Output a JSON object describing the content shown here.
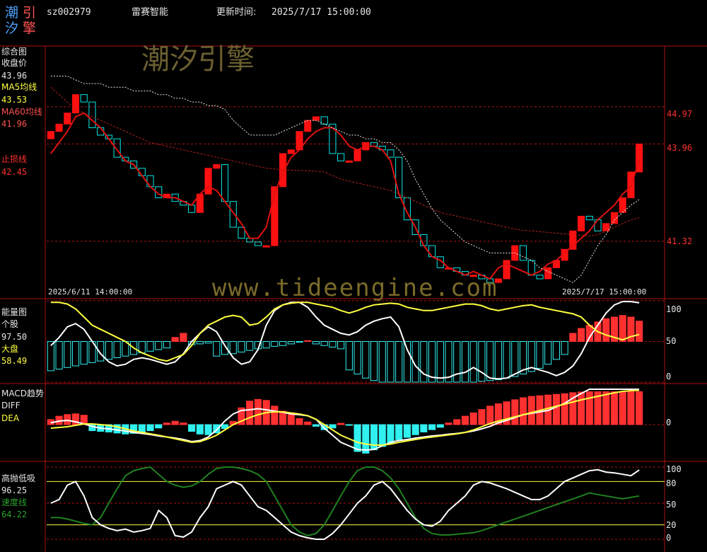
{
  "header": {
    "logo_chars": [
      "潮",
      "引",
      "汐",
      "擎"
    ],
    "code": "sz002979",
    "name": "雷赛智能",
    "update_label": "更新时间:",
    "update_time": "2025/7/17 15:00:00"
  },
  "watermarks": {
    "brand": "潮汐引擎",
    "url": "www.tideengine.com"
  },
  "main_panel": {
    "title": "综合图",
    "close_label": "收盘价",
    "close_value": "43.96",
    "ma5_label": "MA5均线",
    "ma5_value": "43.53",
    "ma60_label": "MA60均线",
    "ma60_value": "41.96",
    "stop_label": "止损线",
    "stop_value": "42.45",
    "price_ticks": [
      "44.97",
      "43.96",
      "41.32"
    ],
    "start_date": "2025/6/11 14:00:00",
    "end_date": "2025/7/17 15:00:00"
  },
  "energy_panel": {
    "title": "能量图",
    "stock_label": "个股",
    "stock_value": "97.50",
    "market_label": "大盘",
    "market_value": "58.49",
    "ticks": [
      "100",
      "50",
      "0"
    ]
  },
  "macd_panel": {
    "title": "MACD趋势",
    "diff_label": "DIFF",
    "dea_label": "DEA",
    "ticks": [
      "0"
    ]
  },
  "hilo_panel": {
    "title": "高抛低吸",
    "value": "96.25",
    "speed_label": "速度线",
    "speed_value": "64.22",
    "ticks": [
      "100",
      "80",
      "50",
      "20",
      "0"
    ]
  },
  "colors": {
    "up": "#ff1010",
    "down": "#00e8e8",
    "ma": "#e01010",
    "ma60": "#b02020",
    "yellow": "#ffff40",
    "white": "#ffffff",
    "green": "#208020",
    "frame": "#b01010",
    "bull": "#ff3030",
    "bear": "#30f0f0"
  },
  "chart_data": [
    {
      "type": "candlestick",
      "title": "综合图",
      "ylim": [
        39.8,
        46.6
      ],
      "x_range": [
        "2025/6/11 14:00:00",
        "2025/7/17 15:00:00"
      ],
      "ticks": [
        44.97,
        43.96,
        41.32
      ],
      "series": [
        {
          "name": "收盘价",
          "values": [
            44.3,
            44.5,
            44.8,
            45.3,
            45.1,
            44.4,
            44.2,
            44.1,
            43.6,
            43.5,
            43.3,
            43.1,
            42.8,
            42.5,
            42.6,
            42.4,
            42.3,
            42.1,
            42.6,
            43.3,
            43.4,
            42.4,
            41.7,
            41.4,
            41.3,
            41.2,
            41.2,
            42.8,
            43.7,
            43.8,
            44.3,
            44.6,
            44.7,
            44.5,
            43.7,
            43.5,
            43.5,
            43.8,
            44.0,
            43.9,
            43.8,
            43.6,
            42.5,
            41.9,
            41.5,
            41.2,
            40.9,
            40.6,
            40.6,
            40.5,
            40.4,
            40.4,
            40.3,
            40.2,
            40.3,
            40.8,
            41.2,
            40.8,
            40.4,
            40.3,
            40.6,
            40.8,
            41.1,
            41.6,
            42.0,
            41.9,
            41.6,
            41.8,
            42.1,
            42.5,
            43.2,
            43.96
          ]
        },
        {
          "name": "MA5均线",
          "values": [
            43.7,
            44.0,
            44.3,
            44.7,
            44.8,
            44.6,
            44.4,
            44.1,
            43.8,
            43.5,
            43.4,
            43.1,
            42.8,
            42.6,
            42.5,
            42.5,
            42.4,
            42.3,
            42.6,
            42.8,
            42.7,
            42.4,
            42.1,
            41.8,
            41.4,
            41.4,
            41.7,
            42.6,
            43.2,
            43.6,
            43.8,
            44.1,
            44.3,
            44.4,
            44.4,
            44.2,
            43.9,
            43.8,
            43.9,
            43.9,
            43.8,
            43.5,
            42.6,
            42.1,
            41.7,
            41.2,
            40.9,
            40.8,
            40.6,
            40.5,
            40.4,
            40.5,
            40.4,
            40.3,
            40.6,
            40.7,
            40.6,
            40.5,
            40.4,
            40.5,
            40.7,
            40.8,
            41.0,
            41.2,
            41.4,
            41.6,
            41.9,
            42.1,
            42.3,
            42.6,
            42.8,
            43.53
          ]
        },
        {
          "name": "MA60均线",
          "values": [
            45.5,
            45.3,
            45.1,
            44.9,
            44.8,
            44.7,
            44.6,
            44.5,
            44.4,
            44.3,
            44.2,
            44.1,
            44.0,
            43.95,
            43.9,
            43.85,
            43.8,
            43.75,
            43.7,
            43.65,
            43.6,
            43.55,
            43.5,
            43.45,
            43.4,
            43.35,
            43.3,
            43.28,
            43.26,
            43.25,
            43.24,
            43.23,
            43.22,
            43.2,
            43.1,
            43.0,
            42.95,
            42.9,
            42.85,
            42.8,
            42.75,
            42.7,
            42.6,
            42.5,
            42.4,
            42.3,
            42.2,
            42.1,
            42.05,
            42.0,
            41.95,
            41.9,
            41.85,
            41.8,
            41.75,
            41.7,
            41.65,
            41.62,
            41.6,
            41.58,
            41.56,
            41.54,
            41.52,
            41.5,
            41.48,
            41.46,
            41.5,
            41.6,
            41.7,
            41.8,
            41.9,
            41.96
          ]
        },
        {
          "name": "止损线",
          "values": [
            45.8,
            45.8,
            45.8,
            45.7,
            45.6,
            45.6,
            45.6,
            45.5,
            45.5,
            45.5,
            45.4,
            45.4,
            45.4,
            45.3,
            45.3,
            45.2,
            45.2,
            45.1,
            45.1,
            45.0,
            45.0,
            44.9,
            44.6,
            44.4,
            44.2,
            44.2,
            44.2,
            44.2,
            44.3,
            44.4,
            44.5,
            44.6,
            44.6,
            44.5,
            44.4,
            44.3,
            44.2,
            44.2,
            44.1,
            44.1,
            44.0,
            44.0,
            43.8,
            43.5,
            43.0,
            42.6,
            42.2,
            41.9,
            41.7,
            41.5,
            41.3,
            41.2,
            41.1,
            41.0,
            41.0,
            41.0,
            41.0,
            40.9,
            40.8,
            40.6,
            40.5,
            40.4,
            40.3,
            40.2,
            40.4,
            40.8,
            41.2,
            41.5,
            41.9,
            42.1,
            42.3,
            42.45
          ]
        }
      ]
    },
    {
      "type": "bar+line",
      "title": "能量图",
      "ylim": [
        0,
        100
      ],
      "ticks": [
        100,
        50,
        0
      ],
      "series": [
        {
          "name": "个股",
          "values": [
            45,
            55,
            68,
            72,
            65,
            50,
            35,
            25,
            20,
            22,
            28,
            30,
            28,
            25,
            22,
            25,
            35,
            50,
            60,
            68,
            62,
            45,
            30,
            22,
            25,
            40,
            70,
            88,
            95,
            98,
            98,
            92,
            80,
            70,
            65,
            60,
            58,
            62,
            70,
            75,
            78,
            80,
            68,
            40,
            20,
            10,
            6,
            5,
            6,
            10,
            12,
            18,
            12,
            5,
            4,
            5,
            10,
            15,
            18,
            15,
            12,
            8,
            12,
            20,
            35,
            55,
            70,
            85,
            95,
            99,
            99,
            97.5
          ]
        },
        {
          "name": "大盘",
          "values": [
            98,
            98,
            96,
            90,
            80,
            70,
            65,
            60,
            55,
            50,
            42,
            36,
            32,
            28,
            26,
            30,
            34,
            45,
            60,
            70,
            75,
            80,
            82,
            80,
            70,
            72,
            80,
            90,
            95,
            97,
            98,
            98,
            96,
            94,
            92,
            88,
            85,
            88,
            92,
            95,
            96,
            97,
            96,
            92,
            90,
            88,
            88,
            90,
            92,
            94,
            96,
            96,
            94,
            90,
            88,
            90,
            92,
            94,
            95,
            92,
            90,
            88,
            86,
            84,
            80,
            70,
            62,
            58,
            55,
            52,
            56,
            58.49
          ]
        },
        {
          "name": "柱",
          "values": [
            -36,
            -34,
            -32,
            -30,
            -28,
            -26,
            -24,
            -22,
            -20,
            -18,
            -16,
            -14,
            -12,
            -10,
            -8,
            5,
            10,
            -4,
            -3,
            -2,
            -18,
            -16,
            -15,
            -13,
            -11,
            -9,
            -8,
            -6,
            -5,
            -3,
            -1,
            1,
            -3,
            -5,
            -7,
            -9,
            -35,
            -40,
            -45,
            -48,
            -50,
            -50,
            -50,
            -50,
            -50,
            -50,
            -50,
            -50,
            -50,
            -50,
            -50,
            -50,
            -49,
            -48,
            -47,
            -45,
            -43,
            -40,
            -37,
            -33,
            -28,
            -22,
            -16,
            10,
            16,
            20,
            24,
            28,
            30,
            32,
            30,
            25
          ]
        }
      ]
    },
    {
      "type": "bar+line",
      "title": "MACD趋势",
      "ylim": [
        -1,
        1
      ],
      "ticks": [
        0
      ],
      "series": [
        {
          "name": "DIFF",
          "values": [
            0.05,
            0.1,
            0.12,
            0.08,
            0.02,
            -0.05,
            -0.1,
            -0.12,
            -0.15,
            -0.18,
            -0.22,
            -0.25,
            -0.28,
            -0.32,
            -0.35,
            -0.38,
            -0.42,
            -0.48,
            -0.45,
            -0.35,
            -0.15,
            0.1,
            0.3,
            0.4,
            0.42,
            0.45,
            0.42,
            0.38,
            0.35,
            0.3,
            0.28,
            0.25,
            0.15,
            -0.1,
            -0.3,
            -0.5,
            -0.6,
            -0.7,
            -0.72,
            -0.7,
            -0.6,
            -0.5,
            -0.45,
            -0.42,
            -0.38,
            -0.35,
            -0.32,
            -0.3,
            -0.27,
            -0.25,
            -0.22,
            -0.18,
            -0.12,
            -0.05,
            0.05,
            0.12,
            0.2,
            0.28,
            0.32,
            0.36,
            0.4,
            0.5,
            0.6,
            0.75,
            0.88,
            1.0,
            1.0,
            1.0,
            1.0,
            1.0,
            1.0,
            1.0
          ]
        },
        {
          "name": "DEA",
          "values": [
            -0.1,
            -0.08,
            -0.06,
            -0.02,
            0.02,
            0.02,
            0.0,
            -0.02,
            -0.06,
            -0.12,
            -0.18,
            -0.22,
            -0.26,
            -0.3,
            -0.35,
            -0.4,
            -0.45,
            -0.5,
            -0.48,
            -0.4,
            -0.3,
            -0.15,
            0.0,
            0.1,
            0.2,
            0.28,
            0.34,
            0.36,
            0.36,
            0.33,
            0.3,
            0.25,
            0.15,
            0.0,
            -0.15,
            -0.3,
            -0.4,
            -0.5,
            -0.55,
            -0.58,
            -0.58,
            -0.55,
            -0.5,
            -0.46,
            -0.42,
            -0.38,
            -0.35,
            -0.32,
            -0.29,
            -0.26,
            -0.22,
            -0.15,
            -0.06,
            0.03,
            0.1,
            0.16,
            0.22,
            0.28,
            0.34,
            0.4,
            0.46,
            0.52,
            0.58,
            0.64,
            0.7,
            0.75,
            0.8,
            0.85,
            0.9,
            0.94,
            0.96,
            0.97
          ]
        },
        {
          "name": "柱",
          "values": [
            0.15,
            0.25,
            0.3,
            0.32,
            0.28,
            -0.18,
            -0.2,
            -0.22,
            -0.25,
            -0.28,
            -0.26,
            -0.22,
            -0.18,
            -0.1,
            0.05,
            0.1,
            0.05,
            -0.2,
            -0.28,
            -0.3,
            -0.25,
            -0.12,
            0.1,
            0.5,
            0.7,
            0.75,
            0.72,
            0.55,
            0.4,
            0.3,
            0.18,
            0.08,
            -0.05,
            -0.15,
            -0.1,
            0.04,
            -0.02,
            -0.8,
            -0.85,
            -0.75,
            -0.65,
            -0.55,
            -0.45,
            -0.38,
            -0.3,
            -0.22,
            -0.15,
            -0.08,
            0.05,
            0.15,
            0.25,
            0.35,
            0.45,
            0.55,
            0.62,
            0.68,
            0.74,
            0.8,
            0.84,
            0.86,
            0.88,
            0.9,
            0.92,
            0.95,
            0.97,
            0.98,
            0.98,
            0.98,
            0.98,
            0.98,
            0.98,
            0.98
          ]
        }
      ]
    },
    {
      "type": "line",
      "title": "高抛低吸",
      "ylim": [
        0,
        100
      ],
      "ticks": [
        100,
        80,
        50,
        20,
        0
      ],
      "series": [
        {
          "name": "高抛低吸",
          "values": [
            50,
            55,
            75,
            80,
            60,
            30,
            20,
            15,
            12,
            14,
            10,
            12,
            15,
            40,
            30,
            5,
            3,
            10,
            30,
            45,
            70,
            75,
            80,
            75,
            60,
            45,
            40,
            30,
            20,
            10,
            5,
            2,
            0,
            0,
            8,
            20,
            35,
            50,
            60,
            75,
            80,
            70,
            55,
            40,
            28,
            20,
            18,
            25,
            40,
            50,
            60,
            75,
            80,
            78,
            74,
            70,
            65,
            60,
            55,
            55,
            60,
            70,
            80,
            85,
            90,
            95,
            96.25,
            93,
            92,
            90,
            88,
            96
          ]
        },
        {
          "name": "速度线",
          "values": [
            30,
            30,
            28,
            25,
            22,
            20,
            30,
            50,
            70,
            88,
            95,
            98,
            100,
            90,
            80,
            75,
            72,
            74,
            80,
            90,
            98,
            100,
            100,
            98,
            95,
            90,
            80,
            60,
            40,
            20,
            10,
            5,
            8,
            20,
            40,
            60,
            80,
            95,
            100,
            100,
            95,
            85,
            70,
            50,
            30,
            15,
            8,
            6,
            6,
            7,
            8,
            9,
            12,
            16,
            20,
            24,
            28,
            32,
            36,
            40,
            44,
            48,
            52,
            56,
            60,
            64.22,
            62,
            60,
            58,
            56,
            58,
            60
          ]
        }
      ]
    }
  ]
}
